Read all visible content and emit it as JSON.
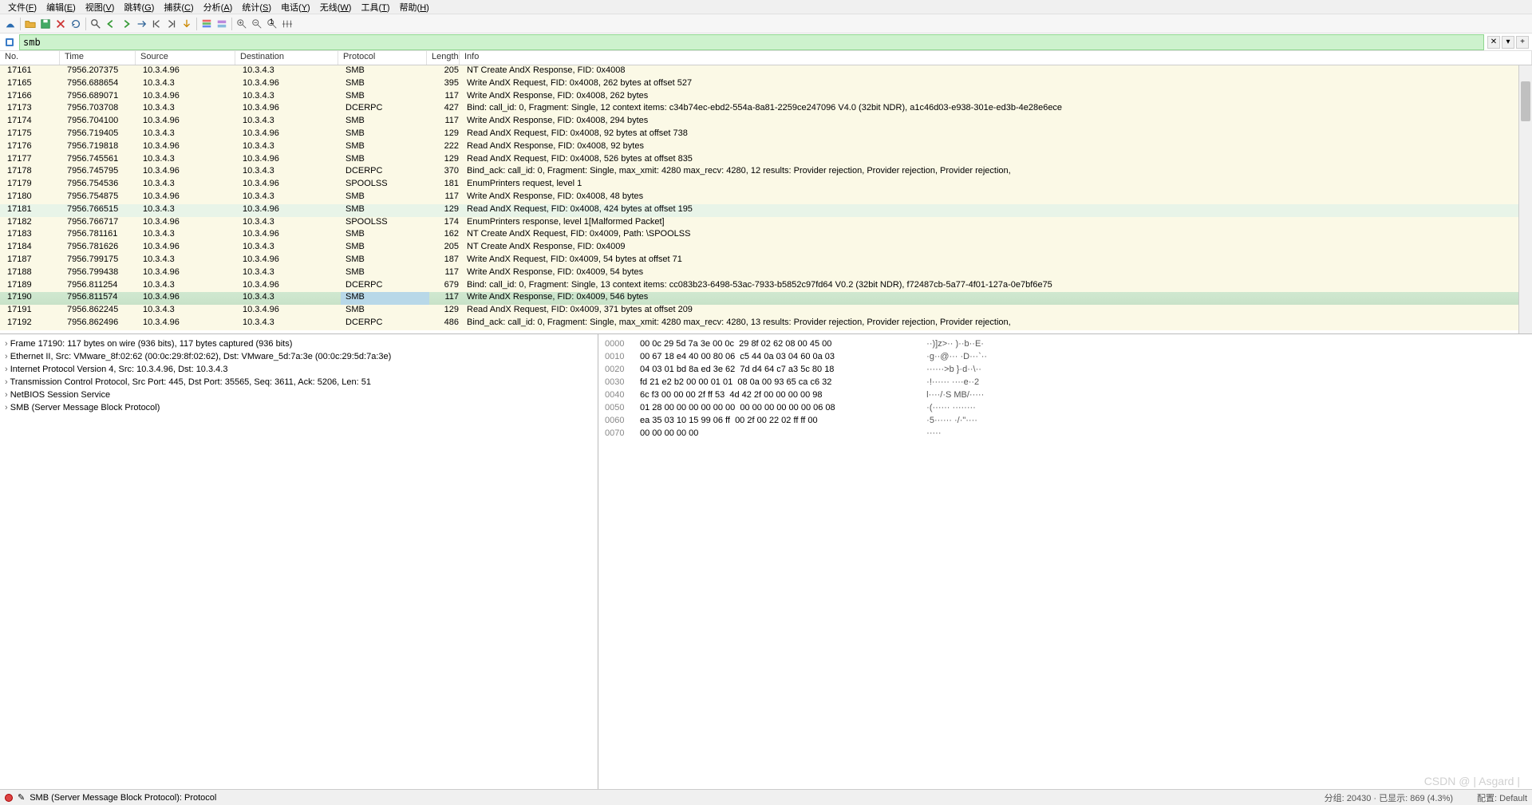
{
  "menus": [
    "文件(F)",
    "编辑(E)",
    "视图(V)",
    "跳转(G)",
    "捕获(C)",
    "分析(A)",
    "统计(S)",
    "电话(Y)",
    "无线(W)",
    "工具(T)",
    "帮助(H)"
  ],
  "filter": {
    "value": "smb"
  },
  "plus": "+",
  "cols": {
    "no": "No.",
    "time": "Time",
    "src": "Source",
    "dst": "Destination",
    "proto": "Protocol",
    "len": "Length",
    "info": "Info"
  },
  "packets": [
    {
      "no": "17161",
      "time": "7956.207375",
      "src": "10.3.4.96",
      "dst": "10.3.4.3",
      "proto": "SMB",
      "len": "205",
      "info": "NT Create AndX Response, FID: 0x4008",
      "cls": "bg-yellow"
    },
    {
      "no": "17165",
      "time": "7956.688654",
      "src": "10.3.4.3",
      "dst": "10.3.4.96",
      "proto": "SMB",
      "len": "395",
      "info": "Write AndX Request, FID: 0x4008, 262 bytes at offset 527",
      "cls": "bg-yellow"
    },
    {
      "no": "17166",
      "time": "7956.689071",
      "src": "10.3.4.96",
      "dst": "10.3.4.3",
      "proto": "SMB",
      "len": "117",
      "info": "Write AndX Response, FID: 0x4008, 262 bytes",
      "cls": "bg-yellow"
    },
    {
      "no": "17173",
      "time": "7956.703708",
      "src": "10.3.4.3",
      "dst": "10.3.4.96",
      "proto": "DCERPC",
      "len": "427",
      "info": "Bind: call_id: 0, Fragment: Single, 12 context items: c34b74ec-ebd2-554a-8a81-2259ce247096 V4.0 (32bit NDR), a1c46d03-e938-301e-ed3b-4e28e6ece",
      "cls": "bg-yellow"
    },
    {
      "no": "17174",
      "time": "7956.704100",
      "src": "10.3.4.96",
      "dst": "10.3.4.3",
      "proto": "SMB",
      "len": "117",
      "info": "Write AndX Response, FID: 0x4008, 294 bytes",
      "cls": "bg-yellow"
    },
    {
      "no": "17175",
      "time": "7956.719405",
      "src": "10.3.4.3",
      "dst": "10.3.4.96",
      "proto": "SMB",
      "len": "129",
      "info": "Read AndX Request, FID: 0x4008, 92 bytes at offset 738",
      "cls": "bg-yellow"
    },
    {
      "no": "17176",
      "time": "7956.719818",
      "src": "10.3.4.96",
      "dst": "10.3.4.3",
      "proto": "SMB",
      "len": "222",
      "info": "Read AndX Response, FID: 0x4008, 92 bytes",
      "cls": "bg-yellow"
    },
    {
      "no": "17177",
      "time": "7956.745561",
      "src": "10.3.4.3",
      "dst": "10.3.4.96",
      "proto": "SMB",
      "len": "129",
      "info": "Read AndX Request, FID: 0x4008, 526 bytes at offset 835",
      "cls": "bg-yellow"
    },
    {
      "no": "17178",
      "time": "7956.745795",
      "src": "10.3.4.96",
      "dst": "10.3.4.3",
      "proto": "DCERPC",
      "len": "370",
      "info": "Bind_ack: call_id: 0, Fragment: Single, max_xmit: 4280 max_recv: 4280, 12 results: Provider rejection, Provider rejection, Provider rejection,",
      "cls": "bg-yellow"
    },
    {
      "no": "17179",
      "time": "7956.754536",
      "src": "10.3.4.3",
      "dst": "10.3.4.96",
      "proto": "SPOOLSS",
      "len": "181",
      "info": "EnumPrinters request, level 1",
      "cls": "bg-yellow"
    },
    {
      "no": "17180",
      "time": "7956.754875",
      "src": "10.3.4.96",
      "dst": "10.3.4.3",
      "proto": "SMB",
      "len": "117",
      "info": "Write AndX Response, FID: 0x4008, 48 bytes",
      "cls": "bg-yellow"
    },
    {
      "no": "17181",
      "time": "7956.766515",
      "src": "10.3.4.3",
      "dst": "10.3.4.96",
      "proto": "SMB",
      "len": "129",
      "info": "Read AndX Request, FID: 0x4008, 424 bytes at offset 195",
      "cls": "bg-sel-light"
    },
    {
      "no": "17182",
      "time": "7956.766717",
      "src": "10.3.4.96",
      "dst": "10.3.4.3",
      "proto": "SPOOLSS",
      "len": "174",
      "info": "EnumPrinters response, level 1[Malformed Packet]",
      "cls": "bg-yellow"
    },
    {
      "no": "17183",
      "time": "7956.781161",
      "src": "10.3.4.3",
      "dst": "10.3.4.96",
      "proto": "SMB",
      "len": "162",
      "info": "NT Create AndX Request, FID: 0x4009, Path: \\SPOOLSS",
      "cls": "bg-yellow"
    },
    {
      "no": "17184",
      "time": "7956.781626",
      "src": "10.3.4.96",
      "dst": "10.3.4.3",
      "proto": "SMB",
      "len": "205",
      "info": "NT Create AndX Response, FID: 0x4009",
      "cls": "bg-yellow"
    },
    {
      "no": "17187",
      "time": "7956.799175",
      "src": "10.3.4.3",
      "dst": "10.3.4.96",
      "proto": "SMB",
      "len": "187",
      "info": "Write AndX Request, FID: 0x4009, 54 bytes at offset 71",
      "cls": "bg-yellow"
    },
    {
      "no": "17188",
      "time": "7956.799438",
      "src": "10.3.4.96",
      "dst": "10.3.4.3",
      "proto": "SMB",
      "len": "117",
      "info": "Write AndX Response, FID: 0x4009, 54 bytes",
      "cls": "bg-yellow"
    },
    {
      "no": "17189",
      "time": "7956.811254",
      "src": "10.3.4.3",
      "dst": "10.3.4.96",
      "proto": "DCERPC",
      "len": "679",
      "info": "Bind: call_id: 0, Fragment: Single, 13 context items: cc083b23-6498-53ac-7933-b5852c97fd64 V0.2 (32bit NDR), f72487cb-5a77-4f01-127a-0e7bf6e75",
      "cls": "bg-yellow"
    },
    {
      "no": "17190",
      "time": "7956.811574",
      "src": "10.3.4.96",
      "dst": "10.3.4.3",
      "proto": "SMB",
      "len": "117",
      "info": "Write AndX Response, FID: 0x4009, 546 bytes",
      "cls": "sel prot-sel"
    },
    {
      "no": "17191",
      "time": "7956.862245",
      "src": "10.3.4.3",
      "dst": "10.3.4.96",
      "proto": "SMB",
      "len": "129",
      "info": "Read AndX Request, FID: 0x4009, 371 bytes at offset 209",
      "cls": "bg-yellow"
    },
    {
      "no": "17192",
      "time": "7956.862496",
      "src": "10.3.4.96",
      "dst": "10.3.4.3",
      "proto": "DCERPC",
      "len": "486",
      "info": "Bind_ack: call_id: 0, Fragment: Single, max_xmit: 4280 max_recv: 4280, 13 results: Provider rejection, Provider rejection, Provider rejection,",
      "cls": "bg-yellow"
    }
  ],
  "details": [
    "Frame 17190: 117 bytes on wire (936 bits), 117 bytes captured (936 bits)",
    "Ethernet II, Src: VMware_8f:02:62 (00:0c:29:8f:02:62), Dst: VMware_5d:7a:3e (00:0c:29:5d:7a:3e)",
    "Internet Protocol Version 4, Src: 10.3.4.96, Dst: 10.3.4.3",
    "Transmission Control Protocol, Src Port: 445, Dst Port: 35565, Seq: 3611, Ack: 5206, Len: 51",
    "NetBIOS Session Service",
    "SMB (Server Message Block Protocol)"
  ],
  "hex": [
    {
      "o": "0000",
      "b": "00 0c 29 5d 7a 3e 00 0c  29 8f 02 62 08 00 45 00",
      "a": "··)]z>·· )··b··E·"
    },
    {
      "o": "0010",
      "b": "00 67 18 e4 40 00 80 06  c5 44 0a 03 04 60 0a 03",
      "a": "·g··@··· ·D···`··"
    },
    {
      "o": "0020",
      "b": "04 03 01 bd 8a ed 3e 62  7d d4 64 c7 a3 5c 80 18",
      "a": "······>b }·d··\\··"
    },
    {
      "o": "0030",
      "b": "fd 21 e2 b2 00 00 01 01  08 0a 00 93 65 ca c6 32",
      "a": "·!······ ····e··2"
    },
    {
      "o": "0040",
      "b": "6c f3 00 00 00 2f ff 53  4d 42 2f 00 00 00 00 98",
      "a": "l····/·S MB/·····"
    },
    {
      "o": "0050",
      "b": "01 28 00 00 00 00 00 00  00 00 00 00 00 00 06 08",
      "a": "·(······ ········"
    },
    {
      "o": "0060",
      "b": "ea 35 03 10 15 99 06 ff  00 2f 00 22 02 ff ff 00",
      "a": "·5······ ·/·\"····"
    },
    {
      "o": "0070",
      "b": "00 00 00 00 00",
      "a": "·····"
    }
  ],
  "status": {
    "left": "SMB (Server Message Block Protocol): Protocol",
    "mid": "分组: 20430 · 已显示: 869 (4.3%)",
    "right": "配置: Default"
  },
  "watermark": "CSDN @ | Asgard |"
}
